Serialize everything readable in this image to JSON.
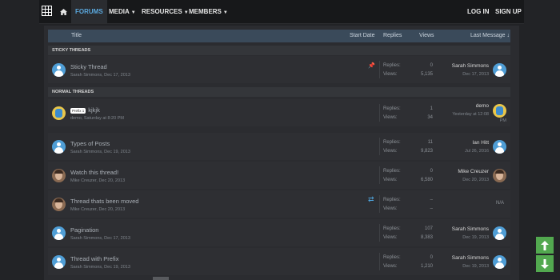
{
  "nav": {
    "items": [
      {
        "label": "FORUMS",
        "active": true
      },
      {
        "label": "MEDIA",
        "has_menu": true
      },
      {
        "label": "RESOURCES",
        "has_menu": true
      },
      {
        "label": "MEMBERS",
        "has_menu": true
      }
    ],
    "login": "LOG IN",
    "signup": "SIGN UP"
  },
  "table": {
    "headers": {
      "title": "Title",
      "start_date": "Start Date",
      "replies": "Replies",
      "views": "Views",
      "last_message": "Last Message ↓"
    }
  },
  "sections": {
    "sticky": "STICKY THREADS",
    "normal": "NORMAL THREADS"
  },
  "labels": {
    "replies": "Replies:",
    "views": "Views:"
  },
  "threads": [
    {
      "title": "Sticky Thread",
      "meta": "Sarah Simmons, Dec 17, 2013",
      "replies": "0",
      "views": "5,135",
      "last_user": "Sarah Simmons",
      "last_date": "Dec 17, 2013"
    },
    {
      "prefix": "Prefix 1",
      "title": "kjkjk",
      "meta": "demo, Saturday at 8:20 PM",
      "replies": "1",
      "views": "34",
      "last_user": "demo",
      "last_date": "Yesterday at 12:08",
      "last_extra": "PM"
    },
    {
      "title": "Types of Posts",
      "meta": "Sarah Simmons, Dec 19, 2013",
      "replies": "11",
      "views": "9,823",
      "last_user": "Ian Hitt",
      "last_date": "Jul 26, 2016"
    },
    {
      "title": "Watch this thread!",
      "meta": "Mike Creuzer, Dec 20, 2013",
      "replies": "0",
      "views": "6,580",
      "last_user": "Mike Creuzer",
      "last_date": "Dec 20, 2013"
    },
    {
      "title": "Thread thats been moved",
      "meta": "Mike Creuzer, Dec 20, 2013",
      "replies": "–",
      "views": "–",
      "na": "N/A"
    },
    {
      "title": "Pagination",
      "meta": "Sarah Simmons, Dec 17, 2013",
      "replies": "107",
      "views": "8,383",
      "last_user": "Sarah Simmons",
      "last_date": "Dec 19, 2013"
    },
    {
      "title": "Thread with Prefix",
      "meta": "Sarah Simmons, Dec 19, 2013",
      "replies": "0",
      "views": "1,210",
      "last_user": "Sarah Simmons",
      "last_date": "Dec 19, 2013"
    }
  ],
  "icons": {
    "home": "home-icon",
    "pin": "pin-icon",
    "moved": "redirect-icon",
    "scroll_up": "arrow-up-icon",
    "scroll_down": "arrow-down-icon"
  },
  "colors": {
    "accent": "#5aa7dc",
    "header_bar": "#3a4a5a",
    "scroll_button": "#52a84f"
  }
}
